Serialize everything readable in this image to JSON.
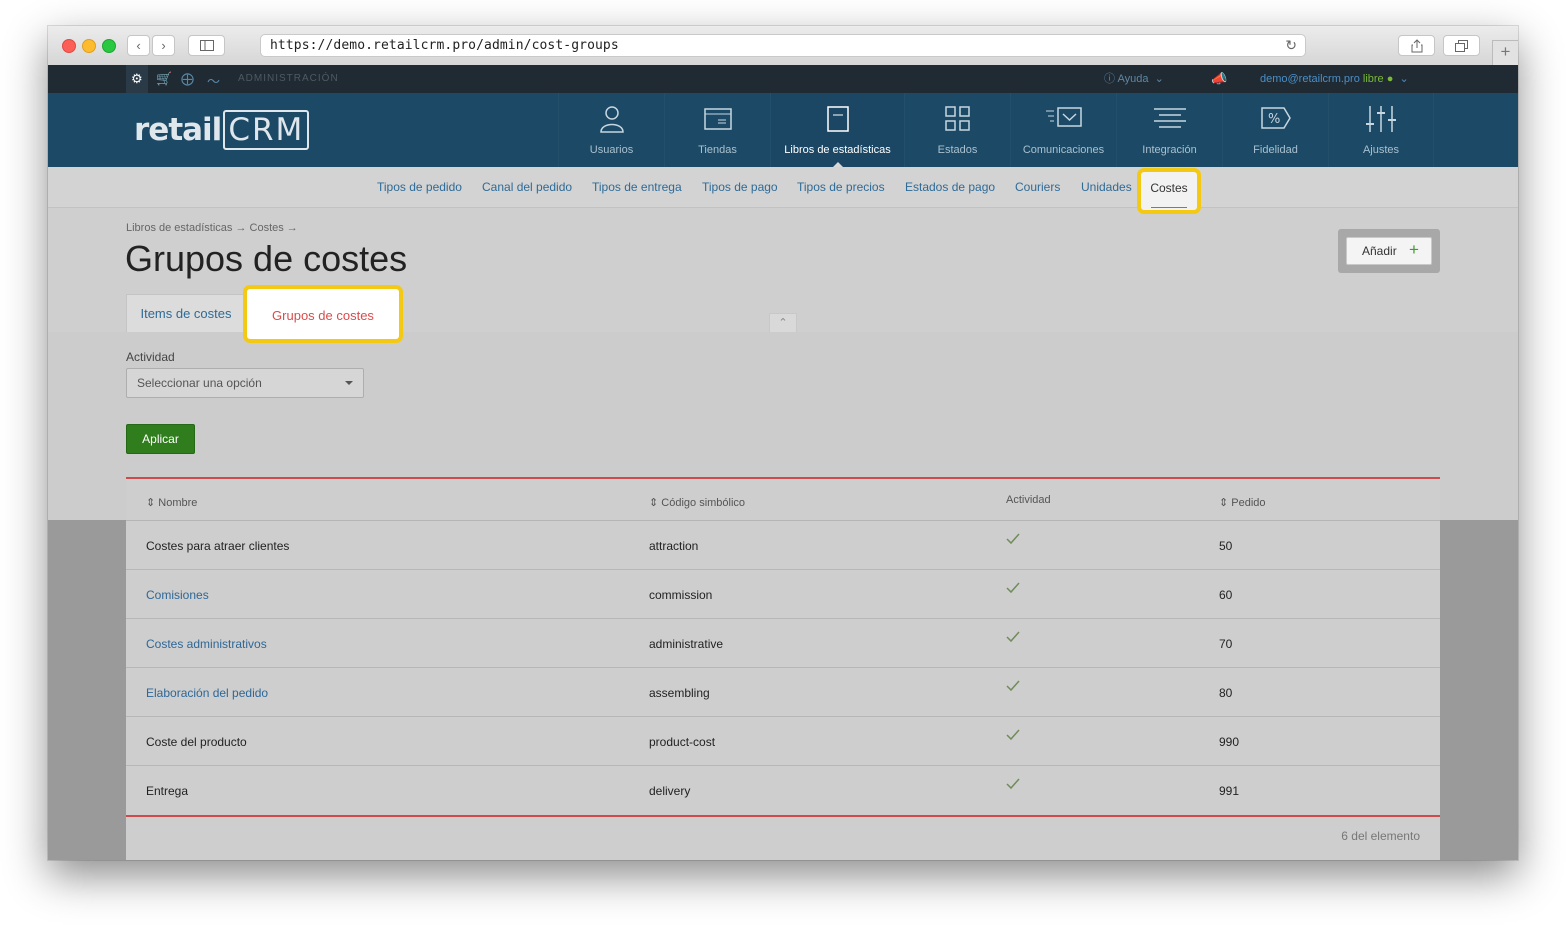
{
  "browser": {
    "url": "https://demo.retailcrm.pro/admin/cost-groups"
  },
  "adminbar": {
    "label": "ADMINISTRACIÓN",
    "help": "Ayuda",
    "user_email": "demo@retailcrm.pro",
    "user_plan": "libre"
  },
  "logo": {
    "text": "retail",
    "boxed": "CRM"
  },
  "mainnav": [
    {
      "label": "Usuarios",
      "icon": "user-icon"
    },
    {
      "label": "Tiendas",
      "icon": "store-icon"
    },
    {
      "label": "Libros de estadísticas",
      "icon": "book-icon",
      "active": true
    },
    {
      "label": "Estados",
      "icon": "states-icon"
    },
    {
      "label": "Comunicaciones",
      "icon": "mail-icon"
    },
    {
      "label": "Integración",
      "icon": "integration-icon"
    },
    {
      "label": "Fidelidad",
      "icon": "percent-icon"
    },
    {
      "label": "Ajustes",
      "icon": "sliders-icon"
    }
  ],
  "subnav": [
    "Tipos de pedido",
    "Canal del pedido",
    "Tipos de entrega",
    "Tipos de pago",
    "Tipos de precios",
    "Estados de pago",
    "Couriers",
    "Unidades",
    "Costes"
  ],
  "header": {
    "breadcrumb": "Libros de estadísticas → Costes →",
    "title": "Grupos de costes",
    "add_button": "Añadir",
    "tabs": [
      "Items de costes",
      "Grupos de costes"
    ]
  },
  "filter": {
    "label": "Actividad",
    "placeholder": "Seleccionar una opción",
    "apply": "Aplicar"
  },
  "table": {
    "columns": [
      "Nombre",
      "Código simbólico",
      "Actividad",
      "Pedido"
    ],
    "rows": [
      {
        "name": "Costes para atraer clientes",
        "code": "attraction",
        "active": true,
        "order": "50",
        "link": false
      },
      {
        "name": "Comisiones",
        "code": "commission",
        "active": true,
        "order": "60",
        "link": true
      },
      {
        "name": "Costes administrativos",
        "code": "administrative",
        "active": true,
        "order": "70",
        "link": true
      },
      {
        "name": "Elaboración del pedido",
        "code": "assembling",
        "active": true,
        "order": "80",
        "link": true
      },
      {
        "name": "Coste del producto",
        "code": "product-cost",
        "active": true,
        "order": "990",
        "link": false
      },
      {
        "name": "Entrega",
        "code": "delivery",
        "active": true,
        "order": "991",
        "link": false
      }
    ],
    "count": "6 del elemento"
  },
  "colors": {
    "highlight": "#f4c914",
    "accent_red": "#cf4a4a",
    "apply_green": "#2f7d1c",
    "nav_bg": "#1c4a66"
  }
}
